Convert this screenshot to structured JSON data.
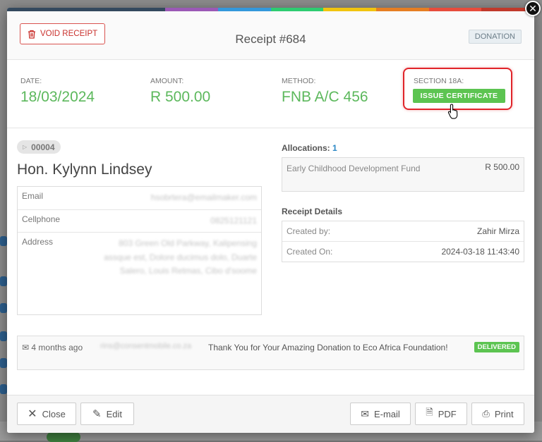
{
  "colors": {
    "accent_green": "#5cb85c",
    "danger_red": "#d9534f",
    "link_blue": "#2a87c5",
    "stripe": [
      "#34495e",
      "#34495e",
      "#34495e",
      "#9b59b6",
      "#3498db",
      "#2ecc71",
      "#f1c40f",
      "#e67e22",
      "#e74c3c",
      "#c0392b"
    ]
  },
  "header": {
    "void_label": "VOID RECEIPT",
    "void_icon": "trash-icon",
    "title": "Receipt #684",
    "type_badge": "DONATION"
  },
  "stats": {
    "date_label": "DATE:",
    "date_value": "18/03/2024",
    "amount_label": "AMOUNT:",
    "amount_value": "R 500.00",
    "method_label": "METHOD:",
    "method_value": "FNB A/C 456",
    "section_label": "SECTION 18A:",
    "certificate_button": "ISSUE CERTIFICATE"
  },
  "contact": {
    "tag": "00004",
    "name": "Hon. Kylynn Lindsey",
    "rows": [
      {
        "key": "Email",
        "value": "hsobrtera@emailmaker.com"
      },
      {
        "key": "Cellphone",
        "value": "0825121121"
      },
      {
        "key": "Address",
        "value": "803 Green Old Parkway, Kalipensing assque est, Dolore ducimus dolo, Duarte Salero, Louis Retmas, Cibo d'soome"
      }
    ]
  },
  "allocations": {
    "title": "Allocations:",
    "count": "1",
    "items": [
      {
        "name": "Early Childhood Development Fund",
        "amount": "R 500.00"
      }
    ]
  },
  "receipt_details": {
    "title": "Receipt Details",
    "rows": [
      {
        "key": "Created by:",
        "value": "Zahir Mirza"
      },
      {
        "key": "Created On:",
        "value": "2024-03-18 11:43:40"
      }
    ]
  },
  "communication": {
    "time": "4 months ago",
    "email": "rins@consentmobile.co.za",
    "subject": "Thank You for Your Amazing Donation to Eco Africa Foundation!",
    "status": "DELIVERED"
  },
  "footer": {
    "close": "Close",
    "edit": "Edit",
    "email": "E-mail",
    "pdf": "PDF",
    "print": "Print"
  }
}
